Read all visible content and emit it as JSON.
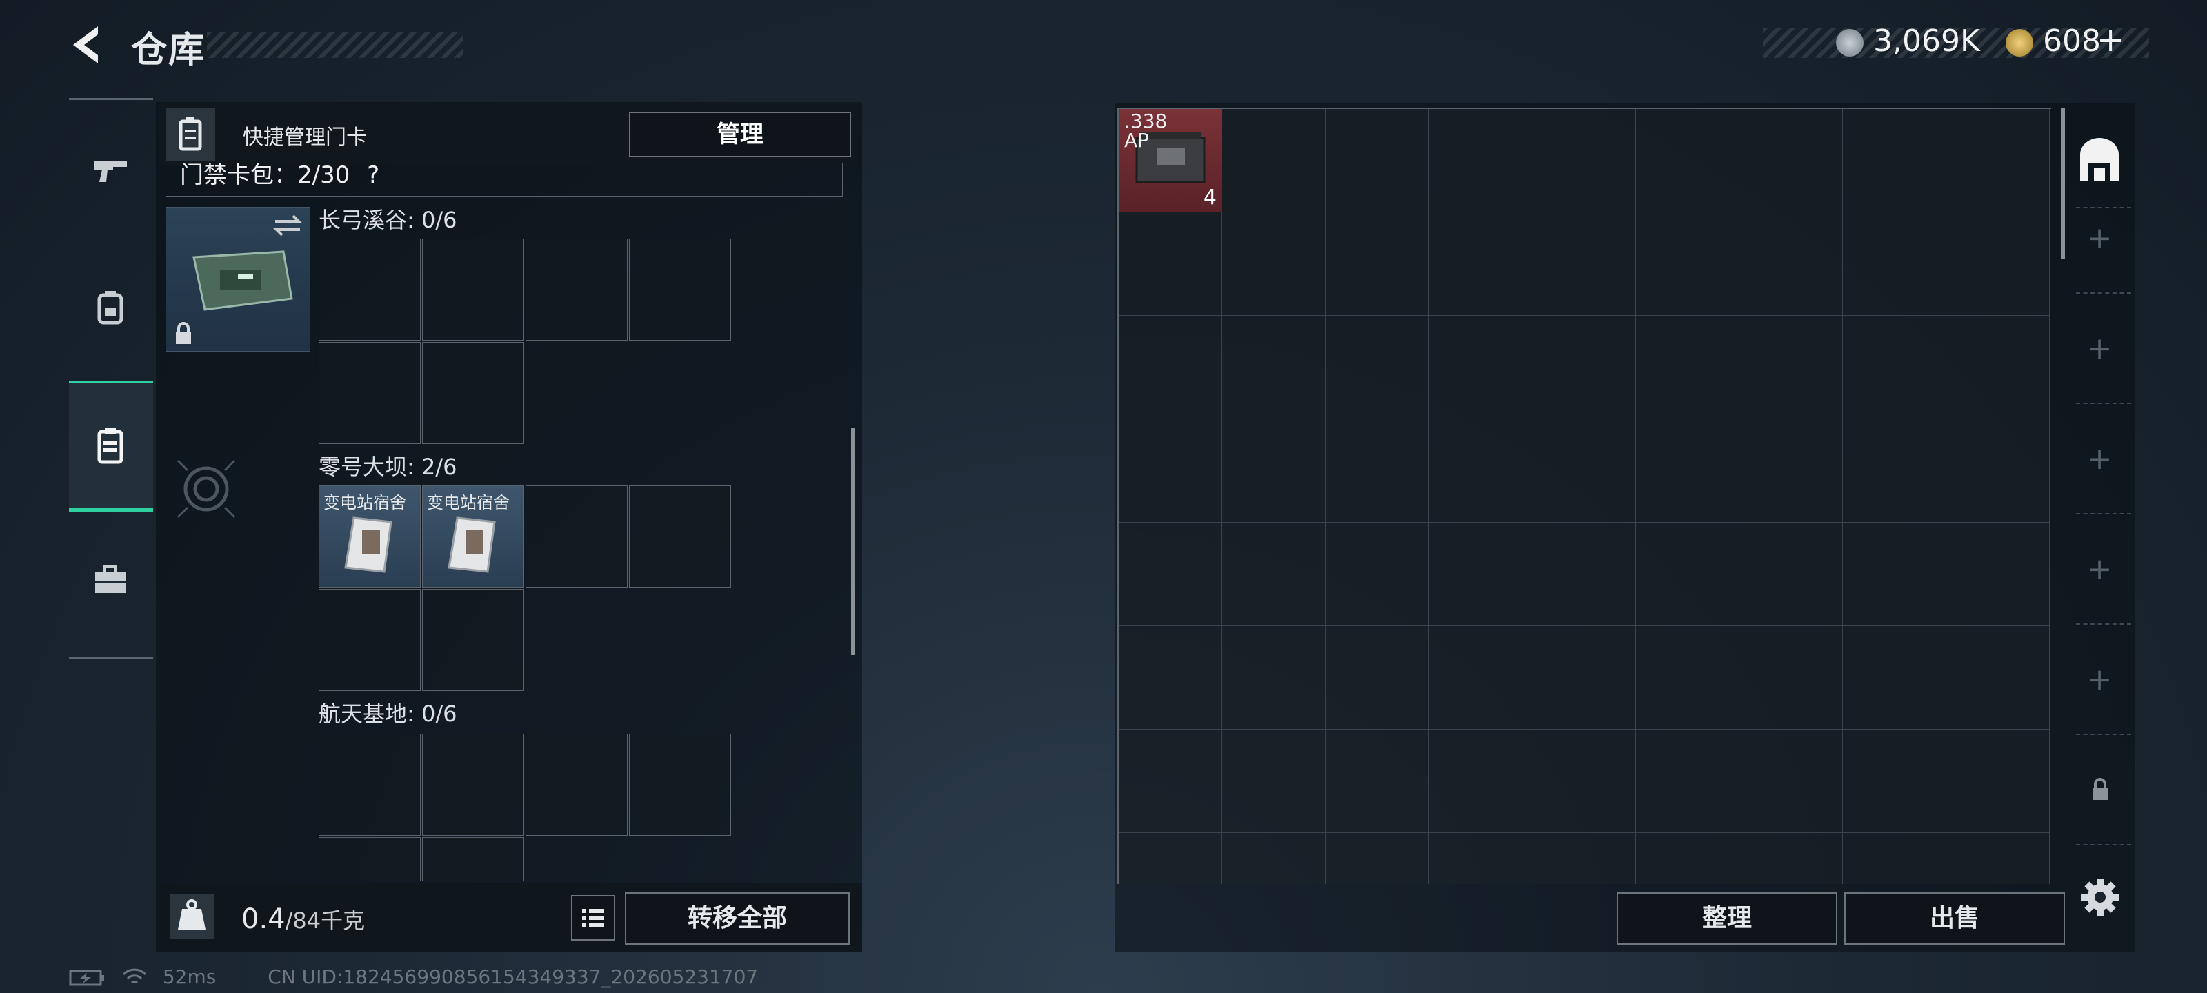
{
  "header": {
    "title": "仓库"
  },
  "currency": {
    "silver": "3,069K",
    "gold": "608",
    "gold_add": "+",
    "silver_color": "#9aa3ab",
    "gold_color": "#c8a84a"
  },
  "rail": {
    "items": [
      {
        "icon": "gun-icon"
      },
      {
        "icon": "backpack-icon"
      },
      {
        "icon": "card-holder-icon",
        "active": true
      },
      {
        "icon": "toolbox-icon"
      }
    ]
  },
  "left_panel": {
    "header_title": "快捷管理门卡",
    "manage_label": "管理",
    "cardpack_label": "门禁卡包：2/30",
    "cardpack_help": "?",
    "zones": [
      {
        "label": "长弓溪谷: 0/6",
        "cards": []
      },
      {
        "label": "零号大坝: 2/6",
        "cards": [
          "变电站宿舍",
          "变电站宿舍"
        ]
      },
      {
        "label": "航天基地: 0/6",
        "cards": []
      }
    ],
    "weight_value": "0.4",
    "weight_cap": "/84千克",
    "transfer_label": "转移全部"
  },
  "right_panel": {
    "item": {
      "name": ".338 AP",
      "count": "4"
    },
    "sort_label": "整理",
    "sell_label": "出售"
  },
  "status_bar": {
    "ping": "52ms",
    "uid": "CN UID:1824569908561543493​37_202605231707"
  },
  "colors": {
    "accent": "#2fd1a0",
    "ammo_bg": "#6a2a30"
  }
}
